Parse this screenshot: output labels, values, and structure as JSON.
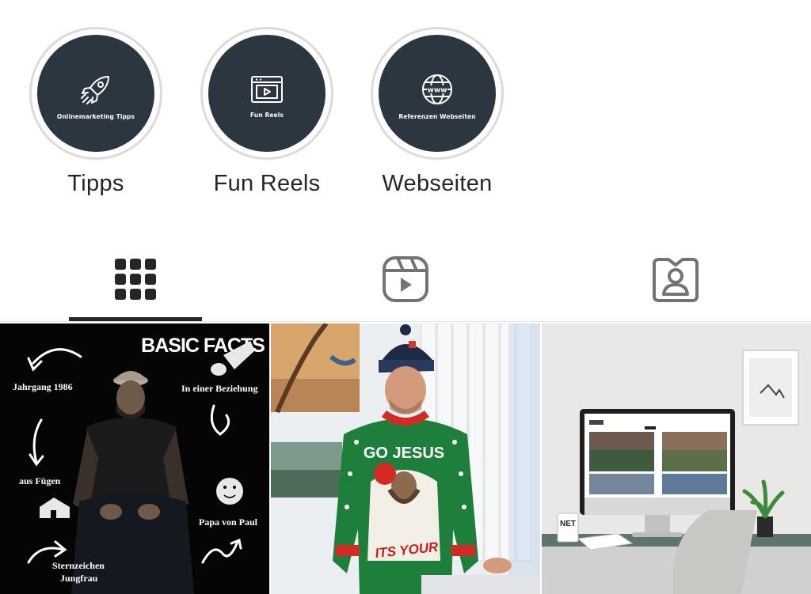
{
  "highlights": [
    {
      "caption": "Onlinemarketing Tipps",
      "label": "Tipps",
      "icon": "rocket-icon"
    },
    {
      "caption": "Fun Reels",
      "label": "Fun Reels",
      "icon": "video-player-icon"
    },
    {
      "caption": "Referenzen Webseiten",
      "label": "Webseiten",
      "icon": "globe-www-icon"
    }
  ],
  "tabs": [
    {
      "name": "posts",
      "icon": "grid-icon",
      "active": true
    },
    {
      "name": "reels",
      "icon": "reels-icon",
      "active": false
    },
    {
      "name": "tagged",
      "icon": "tagged-person-icon",
      "active": false
    }
  ],
  "posts": {
    "basic_facts": {
      "title": "BASIC FACTS",
      "facts": [
        "Jahrgang 1986",
        "In einer Beziehung",
        "aus Fügen",
        "Papa von Paul",
        "Sternzeichen",
        "Jungfrau"
      ]
    },
    "sweater": {
      "text_top": "GO JESUS",
      "text_bottom": "ITS YOUR"
    },
    "monitor": {
      "cup_text": "NET"
    }
  },
  "colors": {
    "highlight_bg": "#2c3640",
    "ring": "#dbdbdb",
    "tab_icon_active": "#262626",
    "tab_icon_inactive": "#737373"
  }
}
